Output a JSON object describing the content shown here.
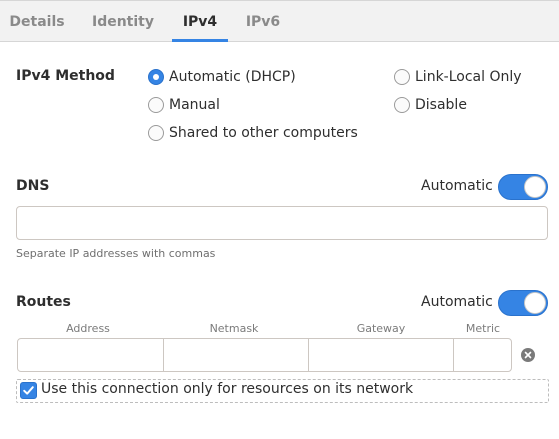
{
  "tabs": [
    {
      "label": "Details",
      "active": false
    },
    {
      "label": "Identity",
      "active": false
    },
    {
      "label": "IPv4",
      "active": true
    },
    {
      "label": "IPv6",
      "active": false
    }
  ],
  "method": {
    "label": "IPv4 Method",
    "options": [
      {
        "label": "Automatic (DHCP)",
        "checked": true
      },
      {
        "label": "Manual",
        "checked": false
      },
      {
        "label": "Shared to other computers",
        "checked": false
      },
      {
        "label": "Link-Local Only",
        "checked": false
      },
      {
        "label": "Disable",
        "checked": false
      }
    ]
  },
  "dns": {
    "label": "DNS",
    "automatic_label": "Automatic",
    "automatic_on": true,
    "value": "",
    "hint": "Separate IP addresses with commas"
  },
  "routes": {
    "label": "Routes",
    "automatic_label": "Automatic",
    "automatic_on": true,
    "columns": [
      "Address",
      "Netmask",
      "Gateway",
      "Metric"
    ],
    "row": {
      "address": "",
      "netmask": "",
      "gateway": "",
      "metric": ""
    }
  },
  "only_resources": {
    "label": "Use this connection only for resources on its network",
    "checked": true
  },
  "colors": {
    "accent": "#3584e4",
    "tabbar_bg": "#f2f2f2"
  }
}
